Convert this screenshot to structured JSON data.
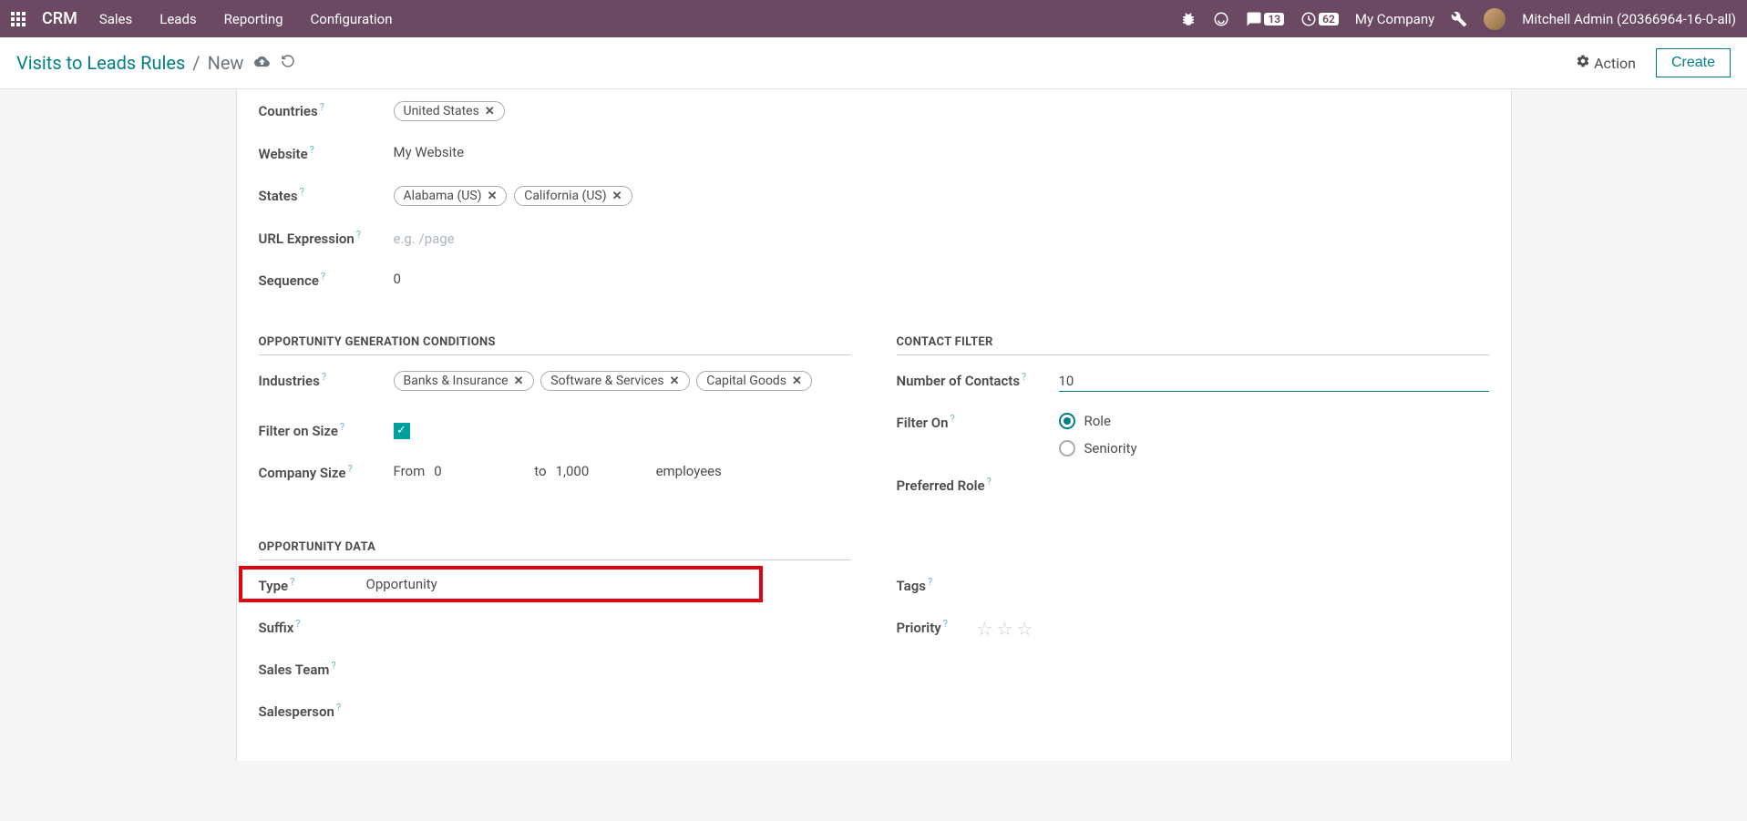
{
  "navbar": {
    "brand": "CRM",
    "menu": [
      "Sales",
      "Leads",
      "Reporting",
      "Configuration"
    ],
    "messages_count": "13",
    "activities_count": "62",
    "company": "My Company",
    "user": "Mitchell Admin (20366964-16-0-all)"
  },
  "control_panel": {
    "breadcrumb_link": "Visits to Leads Rules",
    "breadcrumb_current": "New",
    "action_label": "Action",
    "create_label": "Create"
  },
  "form": {
    "left": {
      "countries_label": "Countries",
      "countries_tags": [
        "United States"
      ],
      "website_label": "Website",
      "website_value": "My Website",
      "states_label": "States",
      "states_tags": [
        "Alabama (US)",
        "California (US)"
      ],
      "url_label": "URL Expression",
      "url_placeholder": "e.g. /page",
      "url_value": "",
      "sequence_label": "Sequence",
      "sequence_value": "0",
      "group_conditions": "OPPORTUNITY GENERATION CONDITIONS",
      "industries_label": "Industries",
      "industries_tags": [
        "Banks & Insurance",
        "Software & Services",
        "Capital Goods"
      ],
      "filter_size_label": "Filter on Size",
      "filter_size_checked": true,
      "company_size_label": "Company Size",
      "company_size_from_label": "From",
      "company_size_from": "0",
      "company_size_to_label": "to",
      "company_size_to": "1,000",
      "company_size_unit": "employees",
      "group_data": "OPPORTUNITY DATA",
      "type_label": "Type",
      "type_value": "Opportunity",
      "suffix_label": "Suffix",
      "sales_team_label": "Sales Team",
      "salesperson_label": "Salesperson"
    },
    "right": {
      "group_contact": "CONTACT FILTER",
      "num_contacts_label": "Number of Contacts",
      "num_contacts_value": "10",
      "filter_on_label": "Filter On",
      "filter_on_role": "Role",
      "filter_on_seniority": "Seniority",
      "preferred_role_label": "Preferred Role",
      "tags_label": "Tags",
      "priority_label": "Priority"
    }
  }
}
